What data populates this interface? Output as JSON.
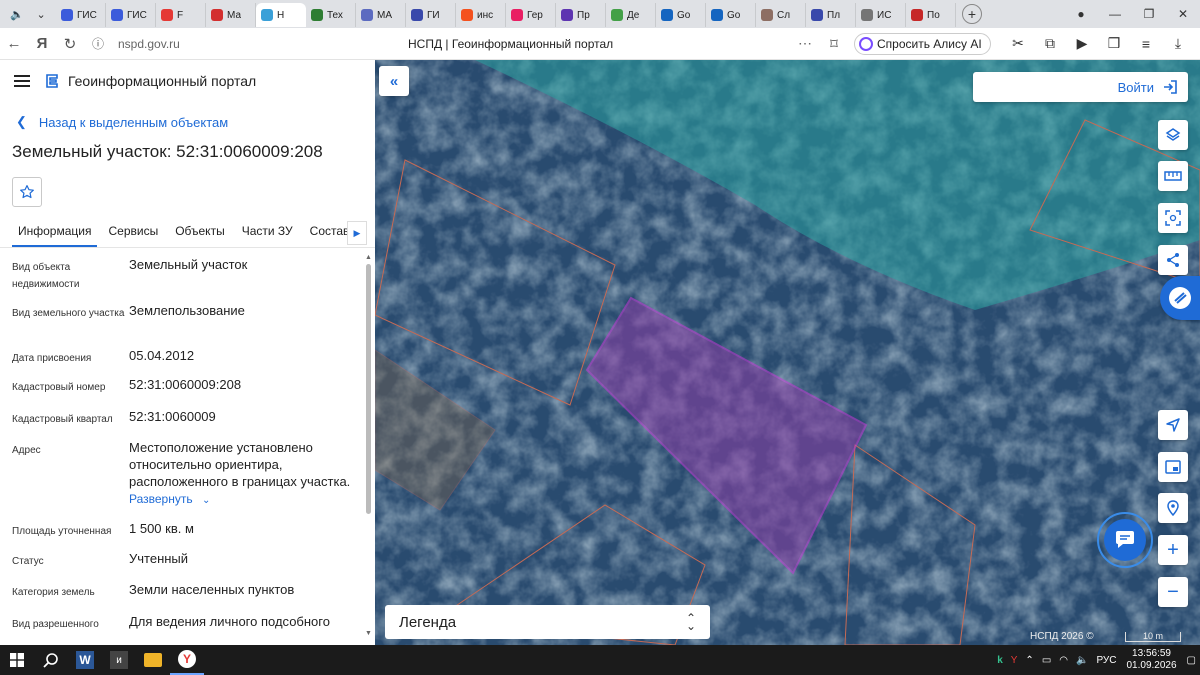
{
  "browser": {
    "tabs": [
      {
        "label": "ГИС",
        "color": "#3b5bdb"
      },
      {
        "label": "ГИС",
        "color": "#3b5bdb"
      },
      {
        "label": "F",
        "color": "#e53935"
      },
      {
        "label": "Ма",
        "color": "#d32f2f"
      },
      {
        "label": "Н",
        "color": "#3aa0d8",
        "active": true
      },
      {
        "label": "Тех",
        "color": "#2e7d32"
      },
      {
        "label": "МА",
        "color": "#5c6bc0"
      },
      {
        "label": "ГИ",
        "color": "#3949ab"
      },
      {
        "label": "инс",
        "color": "#f4511e"
      },
      {
        "label": "Гер",
        "color": "#e91e63"
      },
      {
        "label": "Пр",
        "color": "#5e35b1"
      },
      {
        "label": "Де",
        "color": "#43a047"
      },
      {
        "label": "Go",
        "color": "#1565c0"
      },
      {
        "label": "Go",
        "color": "#1565c0"
      },
      {
        "label": "Сл",
        "color": "#8d6e63"
      },
      {
        "label": "Пл",
        "color": "#3949ab"
      },
      {
        "label": "ИС",
        "color": "#757575"
      },
      {
        "label": "По",
        "color": "#c62828"
      }
    ],
    "url": "nspd.gov.ru",
    "page_title": "НСПД | Геоинформационный портал",
    "alice_label": "Спросить Алису AI"
  },
  "panel": {
    "app_title": "Геоинформационный портал",
    "back_label": "Назад к выделенным объектам",
    "object_title": "Земельный участок: 52:31:0060009:208",
    "tabs": [
      "Информация",
      "Сервисы",
      "Объекты",
      "Части ЗУ",
      "Состав"
    ],
    "properties": [
      {
        "key": "Вид объекта недвижимости",
        "value": "Земельный участок"
      },
      {
        "key": "Вид земельного участка",
        "value": "Землепользование"
      },
      {
        "key": "Дата присвоения",
        "value": "05.04.2012"
      },
      {
        "key": "Кадастровый номер",
        "value": "52:31:0060009:208"
      },
      {
        "key": "Кадастровый квартал",
        "value": "52:31:0060009"
      },
      {
        "key": "Адрес",
        "value": "Местоположение установлено относительно ориентира, расположенного в границах участка."
      },
      {
        "key": "Площадь уточненная",
        "value": "1 500 кв. м"
      },
      {
        "key": "Статус",
        "value": "Учтенный"
      },
      {
        "key": "Категория земель",
        "value": "Земли населенных пунктов"
      },
      {
        "key": "Вид разрешенного",
        "value": "Для ведения личного подсобного"
      }
    ],
    "expand_label": "Развернуть"
  },
  "map": {
    "login_label": "Войти",
    "legend_label": "Легенда",
    "copyright": "НСПД 2026 ©",
    "scale_label": "10 m"
  },
  "taskbar": {
    "lang": "РУС",
    "time": "13:56:59",
    "date": "01.09.2026"
  }
}
